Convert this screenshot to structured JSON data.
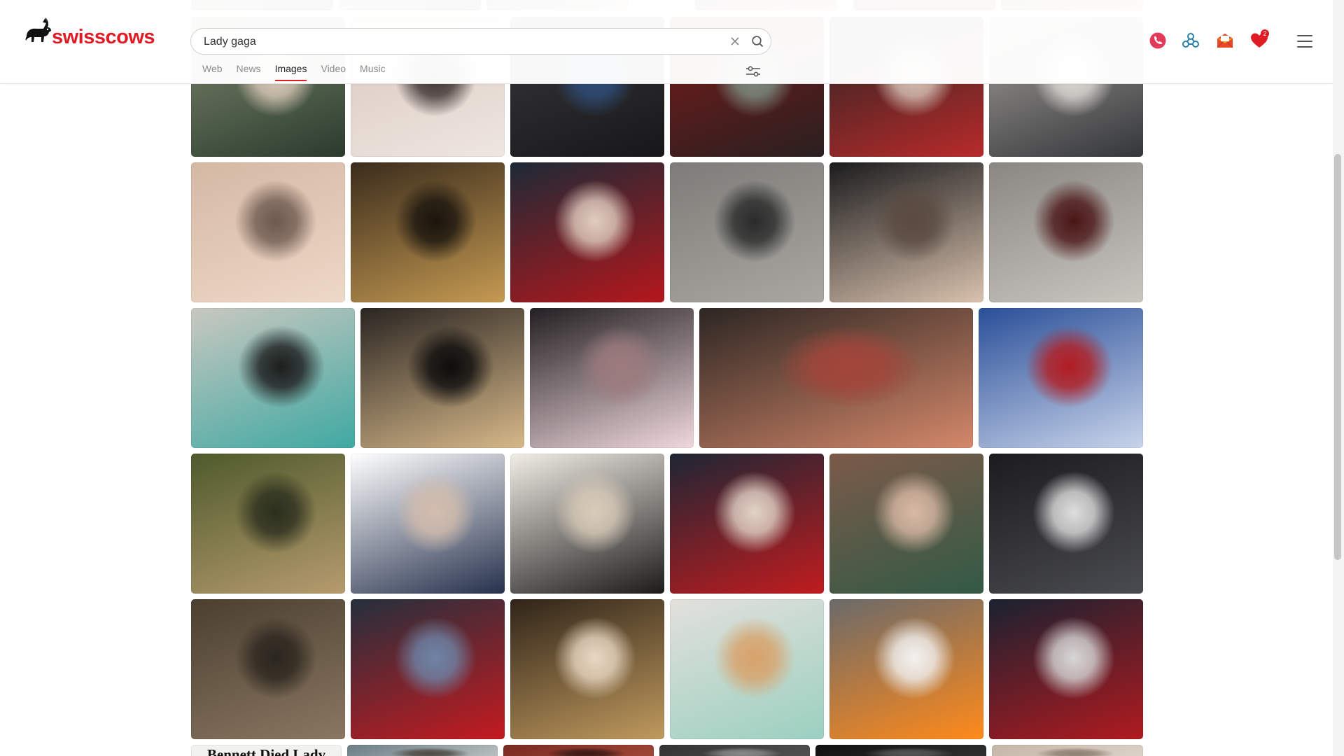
{
  "brand": {
    "name": "swisscows",
    "color": "#df1c25"
  },
  "search": {
    "query": "Lady gaga",
    "clear_icon": "close-icon",
    "submit_icon": "search-icon"
  },
  "tabs": [
    {
      "label": "Web",
      "active": false
    },
    {
      "label": "News",
      "active": false
    },
    {
      "label": "Images",
      "active": true
    },
    {
      "label": "Video",
      "active": false
    },
    {
      "label": "Music",
      "active": false
    }
  ],
  "header_icons": {
    "filter": "sliders-icon",
    "teleguard": "teleguard-icon",
    "vpn": "vpn-icon",
    "email": "swisscows-mail-icon",
    "favorites": "heart-icon",
    "favorites_count": "2",
    "menu": "hamburger-menu-icon"
  },
  "images": {
    "rows": [
      {
        "tiles": [
          {
            "name": "image-joker-makeup-green-sweater"
          },
          {
            "name": "image-sheer-black-dress-necklace"
          },
          {
            "name": "image-tony-bennett-black-suit"
          },
          {
            "name": "image-green-gown-stage"
          },
          {
            "name": "image-tony-bennett-red-dress"
          },
          {
            "name": "image-cigarette-street"
          }
        ]
      },
      {
        "tiles": [
          {
            "name": "image-selfie-with-tony-bennett"
          },
          {
            "name": "image-recording-studio-microphone"
          },
          {
            "name": "image-red-blazer-harlequin"
          },
          {
            "name": "image-stone-stairs-black-coat"
          },
          {
            "name": "image-platinum-curls-portrait"
          },
          {
            "name": "image-dancing-on-stairs"
          }
        ]
      },
      {
        "tiles": [
          {
            "name": "image-teal-hair-with-tony-bennett"
          },
          {
            "name": "image-gold-eye-makeup-press"
          },
          {
            "name": "image-pink-feather-red-carpet"
          },
          {
            "name": "image-orange-hair-closeup"
          },
          {
            "name": "image-blue-backdrop-red-dress"
          }
        ]
      },
      {
        "tiles": [
          {
            "name": "image-joker-face-to-face"
          },
          {
            "name": "image-smudged-makeup-blue-jacket"
          },
          {
            "name": "image-oscars-diamond-necklace"
          },
          {
            "name": "image-police-red-blazer"
          },
          {
            "name": "image-natural-look-green-scarf"
          },
          {
            "name": "image-sequin-dress-microphone"
          }
        ]
      },
      {
        "tiles": [
          {
            "name": "image-stairs-dance-scene"
          },
          {
            "name": "image-police-crowd-red-outfit"
          },
          {
            "name": "image-duet-gold-dress"
          },
          {
            "name": "image-mint-gown-trumpet"
          },
          {
            "name": "image-orange-dress-comic-con"
          },
          {
            "name": "image-joker-split-photo"
          }
        ]
      },
      {
        "tiles": [
          {
            "name": "image-headline-card",
            "text": "Bennett Died Lady"
          },
          {
            "name": "image-partial-1"
          },
          {
            "name": "image-partial-2"
          },
          {
            "name": "image-partial-3"
          },
          {
            "name": "image-partial-4"
          },
          {
            "name": "image-partial-5"
          }
        ]
      }
    ]
  }
}
